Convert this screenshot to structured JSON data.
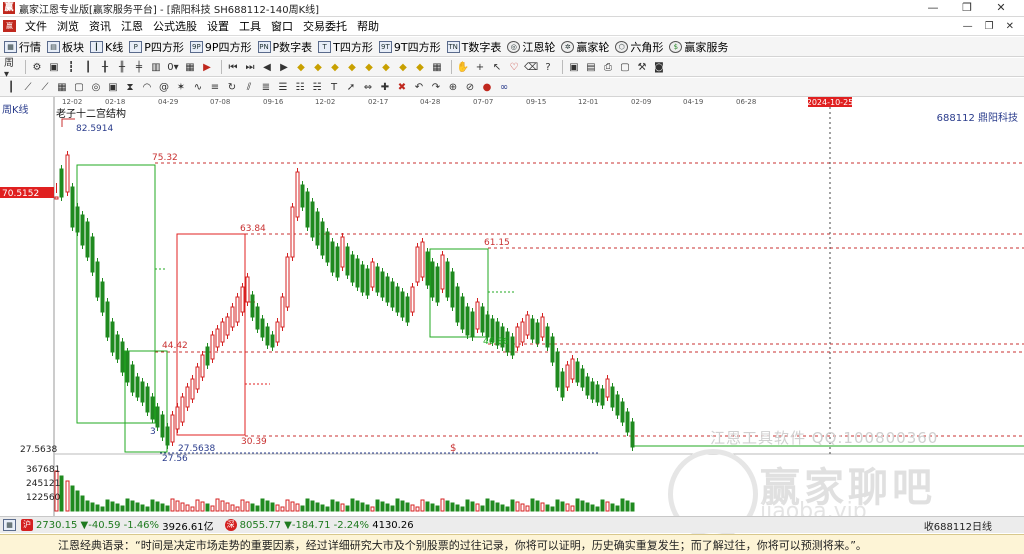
{
  "window": {
    "title": "赢家江恩专业版[赢家服务平台] - [鼎阳科技  SH688112-140周K线]",
    "controls": [
      "—",
      "❐",
      "✕"
    ]
  },
  "menu": [
    "文件",
    "浏览",
    "资讯",
    "江恩",
    "公式选股",
    "设置",
    "工具",
    "窗口",
    "交易委托",
    "帮助"
  ],
  "menu_mdi": [
    "—",
    "❐",
    "✕"
  ],
  "toolbar1": [
    {
      "label": "行情",
      "icon": "grid-icon"
    },
    {
      "label": "板块",
      "icon": "blocks-icon"
    },
    {
      "label": "K线",
      "icon": "kline-icon"
    },
    {
      "label": "P四方形",
      "icon": "p-square-icon"
    },
    {
      "label": "9P四方形",
      "icon": "9p-square-icon"
    },
    {
      "label": "P数字表",
      "icon": "p-table-icon"
    },
    {
      "label": "T四方形",
      "icon": "t-square-icon"
    },
    {
      "label": "9T四方形",
      "icon": "9t-square-icon"
    },
    {
      "label": "T数字表",
      "icon": "t-table-icon"
    },
    {
      "label": "江恩轮",
      "icon": "gann-wheel-icon"
    },
    {
      "label": "赢家轮",
      "icon": "winner-wheel-icon"
    },
    {
      "label": "六角形",
      "icon": "hexagon-icon"
    },
    {
      "label": "赢家服务",
      "icon": "dollar-icon"
    }
  ],
  "chart": {
    "period_label": "周K线",
    "stock_code": "688112  鼎阳科技",
    "structure_label": "老子十二宫结构",
    "highlight_date": "2024-10-25",
    "price_tag": "70.5152",
    "low_axis_label": "27.5638",
    "volume_ticks": [
      "367681",
      "245121",
      "122560"
    ],
    "top_dates": [
      "12-02",
      "02-18",
      "04-29",
      "07-08",
      "09-16",
      "12-02",
      "02-17",
      "04-28",
      "07-07",
      "09-15",
      "12-01",
      "02-09",
      "04-19",
      "06-28"
    ],
    "annotations": {
      "high": "82.5914",
      "p7532": "75.32",
      "p6384": "63.84",
      "p6115": "61.15",
      "p4442": "44.42",
      "p4686": "46.86",
      "p3039": "30.39",
      "p3": "3",
      "p27563": "27.5638",
      "p2756": "27.56",
      "dollar": "$"
    }
  },
  "watermark": {
    "line1": "江恩工具软件  QQ:100800360",
    "line2": "赢家聊吧",
    "line3": "jiaoba.vip"
  },
  "status": {
    "sh": {
      "badge": "沪",
      "value": "2730.15",
      "change": "▼-40.59",
      "pct": "-1.46%",
      "amount": "3926.61亿"
    },
    "sz": {
      "badge": "深",
      "value": "8055.77",
      "change": "▼-184.71",
      "pct": "-2.24%",
      "amount": "4130.26"
    },
    "right": "收688112日线"
  },
  "quote": "江恩经典语录：“时间是决定市场走势的重要因素，经过详细研究大市及个别股票的过往记录，你将可以证明，历史确实重复发生；而了解过往，你将可以预测将来。”。",
  "colors": {
    "up": "#d42020",
    "down": "#1f7a1f",
    "box_green": "#22aa22",
    "box_red": "#e02020",
    "level_line": "#c83030"
  }
}
